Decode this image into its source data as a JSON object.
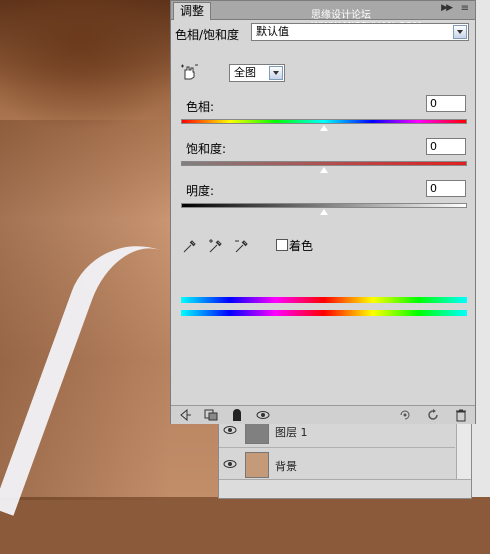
{
  "panel": {
    "tab_label": "调整",
    "watermark": "思缘设计论坛 WWW.MISSYUAN.COM",
    "preset_label": "色相/饱和度",
    "preset_value": "默认值",
    "range_value": "全图",
    "hue": {
      "label": "色相:",
      "value": "0",
      "level": 0.5
    },
    "saturation": {
      "label": "饱和度:",
      "value": "0",
      "level": 0.5
    },
    "lightness": {
      "label": "明度:",
      "value": "0",
      "level": 0.5
    },
    "colorize_label": "着色"
  },
  "layers": {
    "rows": [
      {
        "name": "图层 1"
      },
      {
        "name": "背景"
      }
    ]
  },
  "icons": {
    "hand": "hand-adjust-icon",
    "droppers": [
      "eyedropper-icon",
      "eyedropper-plus-icon",
      "eyedropper-minus-icon"
    ],
    "bottom": [
      "back-arrow-icon",
      "clip-layer-icon",
      "mask-icon",
      "eye-icon",
      "previous-state-icon",
      "reset-icon",
      "trash-icon"
    ]
  }
}
